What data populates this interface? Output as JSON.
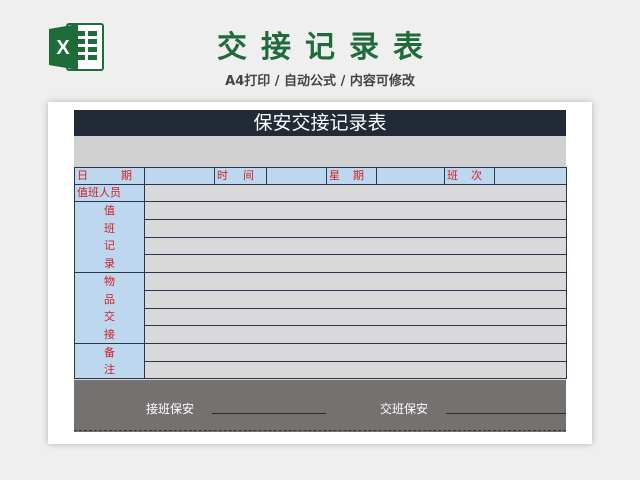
{
  "banner": {
    "logo_letter": "X",
    "title": "交接记录表",
    "subtitle": "A4打印 / 自动公式 / 内容可修改"
  },
  "sheet": {
    "title": "保安交接记录表",
    "header_row": {
      "date": [
        "日",
        "期"
      ],
      "time": [
        "时",
        "间"
      ],
      "weekday": [
        "星",
        "期"
      ],
      "shift": [
        "班",
        "次"
      ]
    },
    "staff_label": "值班人员",
    "sections": [
      {
        "name": "duty_record",
        "chars": [
          "值",
          "班",
          "记",
          "录"
        ],
        "rows": 4
      },
      {
        "name": "items_handover",
        "chars": [
          "物",
          "品",
          "交",
          "接"
        ],
        "rows": 4
      },
      {
        "name": "remarks",
        "chars": [
          "备",
          "注"
        ],
        "rows": 2
      }
    ],
    "footer": {
      "receiver_label": "接班保安",
      "handover_label": "交班保安"
    }
  },
  "colors": {
    "title_bar": "#222a35",
    "label_fill": "#bdd7ee",
    "label_text": "#d02020",
    "footer_fill": "#767171",
    "brand_green": "#1f6b3a"
  }
}
